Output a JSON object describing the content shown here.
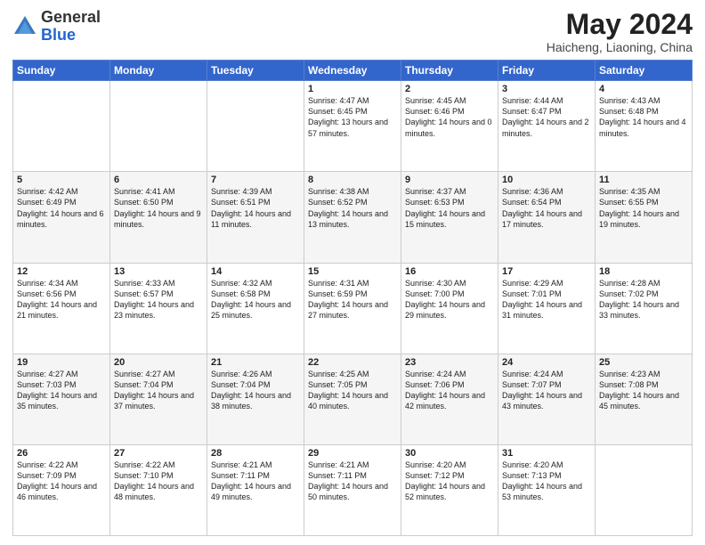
{
  "header": {
    "logo_general": "General",
    "logo_blue": "Blue",
    "month_title": "May 2024",
    "location": "Haicheng, Liaoning, China"
  },
  "days_of_week": [
    "Sunday",
    "Monday",
    "Tuesday",
    "Wednesday",
    "Thursday",
    "Friday",
    "Saturday"
  ],
  "weeks": [
    [
      {
        "day": "",
        "info": ""
      },
      {
        "day": "",
        "info": ""
      },
      {
        "day": "",
        "info": ""
      },
      {
        "day": "1",
        "info": "Sunrise: 4:47 AM\nSunset: 6:45 PM\nDaylight: 13 hours and 57 minutes."
      },
      {
        "day": "2",
        "info": "Sunrise: 4:45 AM\nSunset: 6:46 PM\nDaylight: 14 hours and 0 minutes."
      },
      {
        "day": "3",
        "info": "Sunrise: 4:44 AM\nSunset: 6:47 PM\nDaylight: 14 hours and 2 minutes."
      },
      {
        "day": "4",
        "info": "Sunrise: 4:43 AM\nSunset: 6:48 PM\nDaylight: 14 hours and 4 minutes."
      }
    ],
    [
      {
        "day": "5",
        "info": "Sunrise: 4:42 AM\nSunset: 6:49 PM\nDaylight: 14 hours and 6 minutes."
      },
      {
        "day": "6",
        "info": "Sunrise: 4:41 AM\nSunset: 6:50 PM\nDaylight: 14 hours and 9 minutes."
      },
      {
        "day": "7",
        "info": "Sunrise: 4:39 AM\nSunset: 6:51 PM\nDaylight: 14 hours and 11 minutes."
      },
      {
        "day": "8",
        "info": "Sunrise: 4:38 AM\nSunset: 6:52 PM\nDaylight: 14 hours and 13 minutes."
      },
      {
        "day": "9",
        "info": "Sunrise: 4:37 AM\nSunset: 6:53 PM\nDaylight: 14 hours and 15 minutes."
      },
      {
        "day": "10",
        "info": "Sunrise: 4:36 AM\nSunset: 6:54 PM\nDaylight: 14 hours and 17 minutes."
      },
      {
        "day": "11",
        "info": "Sunrise: 4:35 AM\nSunset: 6:55 PM\nDaylight: 14 hours and 19 minutes."
      }
    ],
    [
      {
        "day": "12",
        "info": "Sunrise: 4:34 AM\nSunset: 6:56 PM\nDaylight: 14 hours and 21 minutes."
      },
      {
        "day": "13",
        "info": "Sunrise: 4:33 AM\nSunset: 6:57 PM\nDaylight: 14 hours and 23 minutes."
      },
      {
        "day": "14",
        "info": "Sunrise: 4:32 AM\nSunset: 6:58 PM\nDaylight: 14 hours and 25 minutes."
      },
      {
        "day": "15",
        "info": "Sunrise: 4:31 AM\nSunset: 6:59 PM\nDaylight: 14 hours and 27 minutes."
      },
      {
        "day": "16",
        "info": "Sunrise: 4:30 AM\nSunset: 7:00 PM\nDaylight: 14 hours and 29 minutes."
      },
      {
        "day": "17",
        "info": "Sunrise: 4:29 AM\nSunset: 7:01 PM\nDaylight: 14 hours and 31 minutes."
      },
      {
        "day": "18",
        "info": "Sunrise: 4:28 AM\nSunset: 7:02 PM\nDaylight: 14 hours and 33 minutes."
      }
    ],
    [
      {
        "day": "19",
        "info": "Sunrise: 4:27 AM\nSunset: 7:03 PM\nDaylight: 14 hours and 35 minutes."
      },
      {
        "day": "20",
        "info": "Sunrise: 4:27 AM\nSunset: 7:04 PM\nDaylight: 14 hours and 37 minutes."
      },
      {
        "day": "21",
        "info": "Sunrise: 4:26 AM\nSunset: 7:04 PM\nDaylight: 14 hours and 38 minutes."
      },
      {
        "day": "22",
        "info": "Sunrise: 4:25 AM\nSunset: 7:05 PM\nDaylight: 14 hours and 40 minutes."
      },
      {
        "day": "23",
        "info": "Sunrise: 4:24 AM\nSunset: 7:06 PM\nDaylight: 14 hours and 42 minutes."
      },
      {
        "day": "24",
        "info": "Sunrise: 4:24 AM\nSunset: 7:07 PM\nDaylight: 14 hours and 43 minutes."
      },
      {
        "day": "25",
        "info": "Sunrise: 4:23 AM\nSunset: 7:08 PM\nDaylight: 14 hours and 45 minutes."
      }
    ],
    [
      {
        "day": "26",
        "info": "Sunrise: 4:22 AM\nSunset: 7:09 PM\nDaylight: 14 hours and 46 minutes."
      },
      {
        "day": "27",
        "info": "Sunrise: 4:22 AM\nSunset: 7:10 PM\nDaylight: 14 hours and 48 minutes."
      },
      {
        "day": "28",
        "info": "Sunrise: 4:21 AM\nSunset: 7:11 PM\nDaylight: 14 hours and 49 minutes."
      },
      {
        "day": "29",
        "info": "Sunrise: 4:21 AM\nSunset: 7:11 PM\nDaylight: 14 hours and 50 minutes."
      },
      {
        "day": "30",
        "info": "Sunrise: 4:20 AM\nSunset: 7:12 PM\nDaylight: 14 hours and 52 minutes."
      },
      {
        "day": "31",
        "info": "Sunrise: 4:20 AM\nSunset: 7:13 PM\nDaylight: 14 hours and 53 minutes."
      },
      {
        "day": "",
        "info": ""
      }
    ]
  ]
}
